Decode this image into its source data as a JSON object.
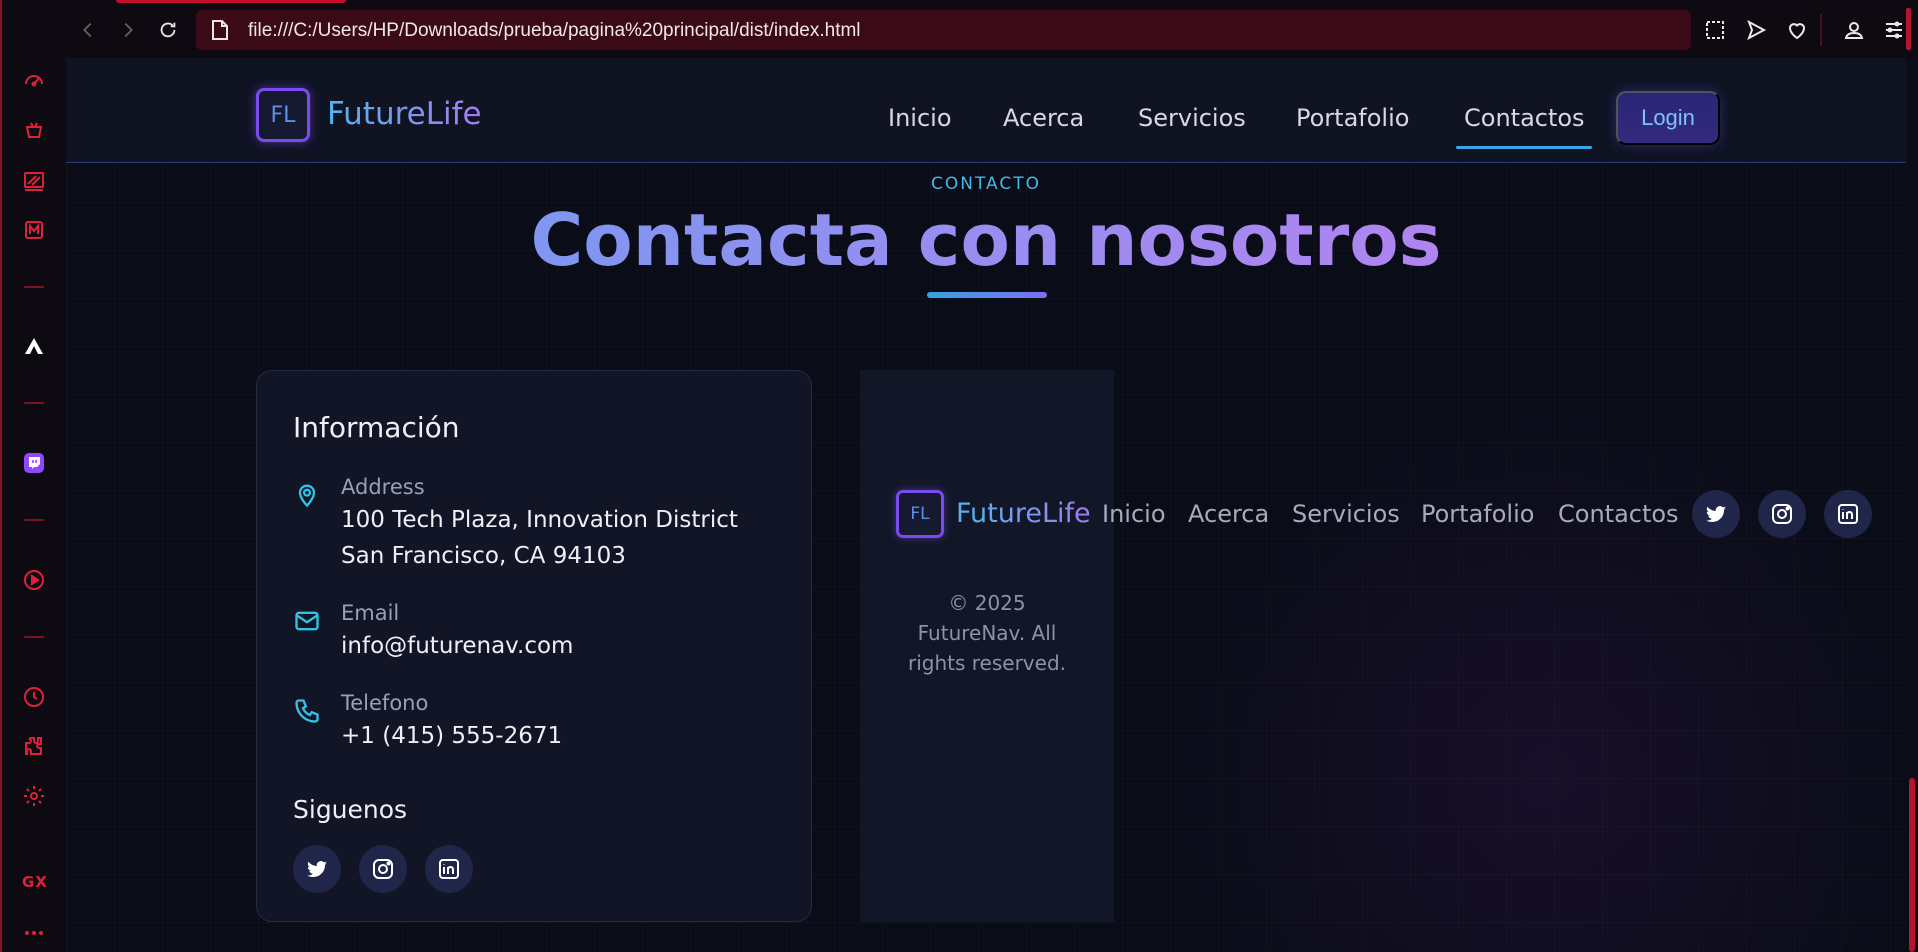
{
  "browser": {
    "url": "file:///C:/Users/HP/Downloads/prueba/pagina%20principal/dist/index.html",
    "rail_label": "GX"
  },
  "site": {
    "logo_mark": "FL",
    "brand": "FutureLife",
    "nav": [
      "Inicio",
      "Acerca",
      "Servicios",
      "Portafolio",
      "Contactos"
    ],
    "active_nav": "Contactos",
    "login": "Login"
  },
  "contact": {
    "kicker": "CONTACTO",
    "title": "Contacta con nosotros",
    "info_title": "Información",
    "address_label": "Address",
    "address_line1": "100 Tech Plaza, Innovation District",
    "address_line2": "San Francisco, CA 94103",
    "email_label": "Email",
    "email": "info@futurenav.com",
    "phone_label": "Telefono",
    "phone": "+1 (415) 555-2671",
    "follow_title": "Siguenos",
    "social": [
      "twitter-icon",
      "instagram-icon",
      "linkedin-icon"
    ]
  },
  "footer": {
    "logo_mark": "FL",
    "brand": "FutureLife",
    "links": [
      "Inicio",
      "Acerca",
      "Servicios",
      "Portafolio",
      "Contactos"
    ],
    "copyright_line1": "© 2025",
    "copyright_line2": "FutureNav. All",
    "copyright_line3": "rights reserved."
  },
  "colors": {
    "accent_red": "#c5102c",
    "brand_gradient_start": "#4fb5f0",
    "brand_gradient_end": "#a57cf0",
    "cyan": "#45b7e8",
    "background": "#0a0c18"
  }
}
